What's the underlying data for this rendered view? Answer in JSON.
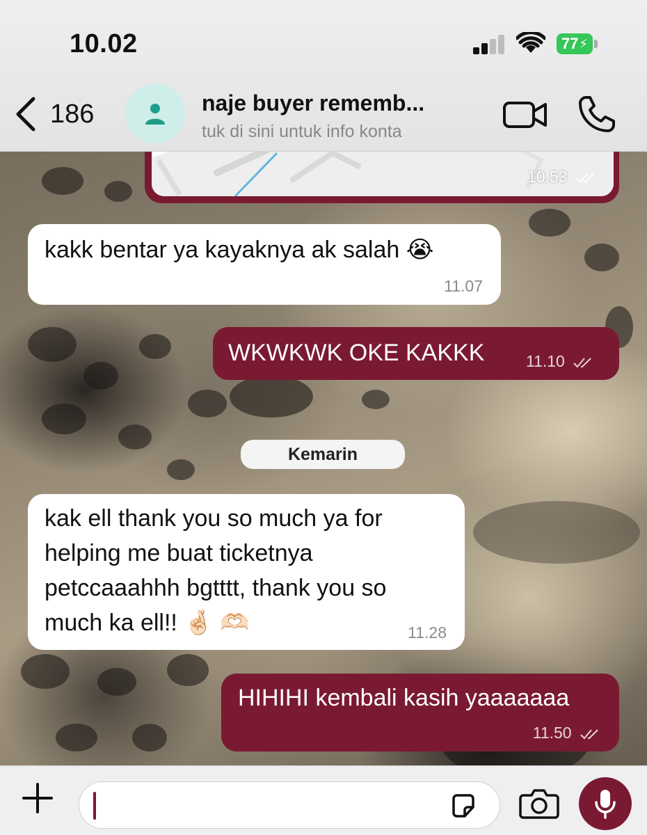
{
  "status_bar": {
    "time": "10.02",
    "battery": "77"
  },
  "header": {
    "back_count": "186",
    "contact_name": "naje buyer rememb...",
    "contact_subtitle": "tuk di sini untuk info konta"
  },
  "messages": [
    {
      "direction": "out",
      "type": "location",
      "time": "10.53",
      "read": true
    },
    {
      "direction": "in",
      "text": "kakk bentar ya kayaknya ak salah 😭",
      "time": "11.07"
    },
    {
      "direction": "out",
      "text": "WKWKWK OKE KAKKK",
      "time": "11.10",
      "read": true
    },
    {
      "direction": "in",
      "lines": [
        "kak ell thank you so much ya for",
        "helping me buat ticketnya",
        "petccaaahhh bgtttt, thank you so",
        "much ka ell!! 🤞🏻 🫶🏻"
      ],
      "time": "11.28"
    },
    {
      "direction": "out",
      "text": "HIHIHI kembali kasih yaaaaaaa",
      "time": "11.50",
      "read": true
    }
  ],
  "day_separator": "Kemarin",
  "colors": {
    "outgoing_bubble": "#7a1a32",
    "incoming_bubble": "#ffffff",
    "avatar_bg": "#cfeeea",
    "avatar_icon": "#1e9e8a"
  },
  "icons": [
    "chevron-left-icon",
    "person-icon",
    "video-camera-icon",
    "phone-icon",
    "plus-icon",
    "sticker-icon",
    "camera-icon",
    "microphone-icon",
    "double-check-icon"
  ]
}
